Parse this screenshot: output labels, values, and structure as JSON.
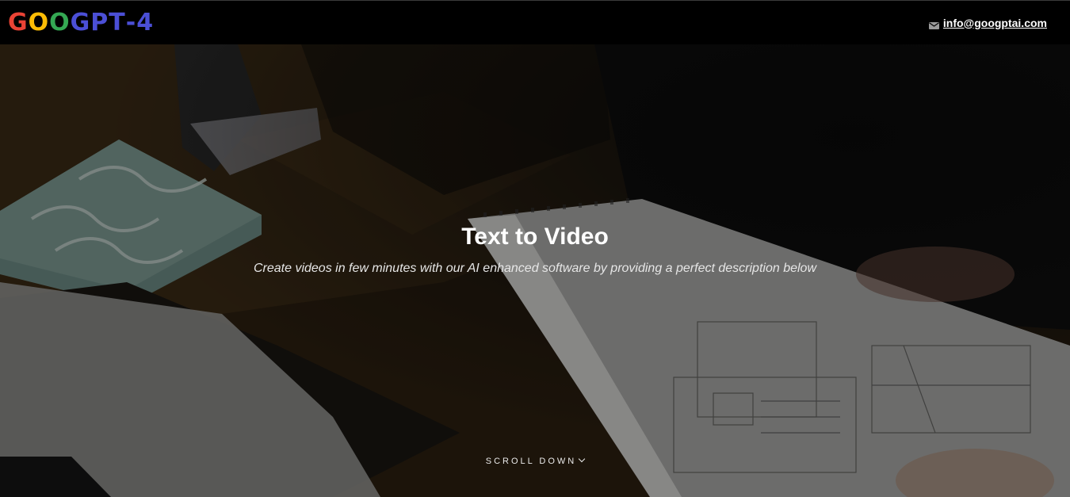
{
  "header": {
    "logo_letters": [
      {
        "char": "G",
        "color": "#ea4335"
      },
      {
        "char": "O",
        "color": "#fbbc05"
      },
      {
        "char": "O",
        "color": "#34a853"
      },
      {
        "char": "G",
        "color": "#4b4fd6"
      },
      {
        "char": "P",
        "color": "#4b4fd6"
      },
      {
        "char": "T",
        "color": "#4b4fd6"
      },
      {
        "char": "-",
        "color": "#4b4fd6"
      },
      {
        "char": "4",
        "color": "#4b4fd6"
      }
    ],
    "email_icon": "envelope-icon",
    "email": "info@googptai.com"
  },
  "hero": {
    "title": "Text to Video",
    "subtitle": "Create videos in few minutes with our AI enhanced software by providing a perfect description below",
    "scroll_label": "SCROLL DOWN",
    "scroll_icon": "chevron-down-icon"
  }
}
